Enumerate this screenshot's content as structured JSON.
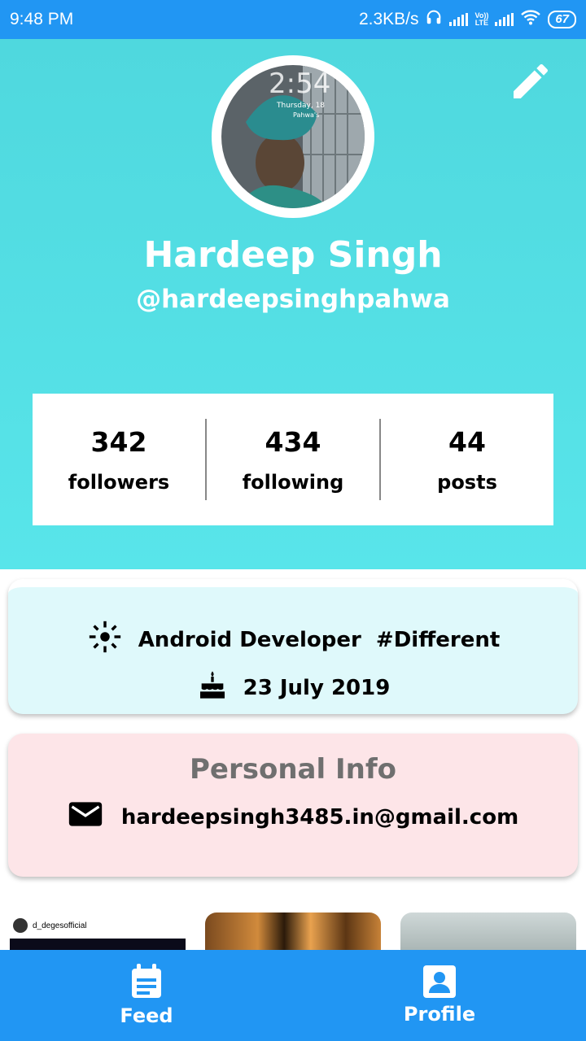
{
  "status_bar": {
    "time": "9:48 PM",
    "net_speed": "2.3KB/s",
    "volte_label_1": "Vo))",
    "volte_label_2": "LTE",
    "battery": "67"
  },
  "profile": {
    "name": "Hardeep Singh",
    "handle": "@hardeepsinghpahwa",
    "avatar_overlay_time": "2:54",
    "avatar_overlay_date": "Thursday, 18",
    "avatar_overlay_name": "Pahwa's"
  },
  "stats": [
    {
      "value": "342",
      "label": "followers"
    },
    {
      "value": "434",
      "label": "following"
    },
    {
      "value": "44",
      "label": "posts"
    }
  ],
  "bio": {
    "text": "Android Developer  #Different",
    "date": "23 July 2019",
    "bio_icon": "sparkle-icon",
    "date_icon": "cake-icon"
  },
  "personal_info": {
    "title": "Personal Info",
    "email": "hardeepsingh3485.in@gmail.com",
    "email_icon": "mail-icon"
  },
  "thumbnails": [
    {
      "username": "d_degesofficial"
    },
    {},
    {}
  ],
  "bottom_nav": {
    "feed_label": "Feed",
    "profile_label": "Profile"
  },
  "colors": {
    "primary": "#2196f3",
    "header": "#55e0e5",
    "bio_card": "#dff9fb",
    "info_card": "#fde5e8"
  }
}
